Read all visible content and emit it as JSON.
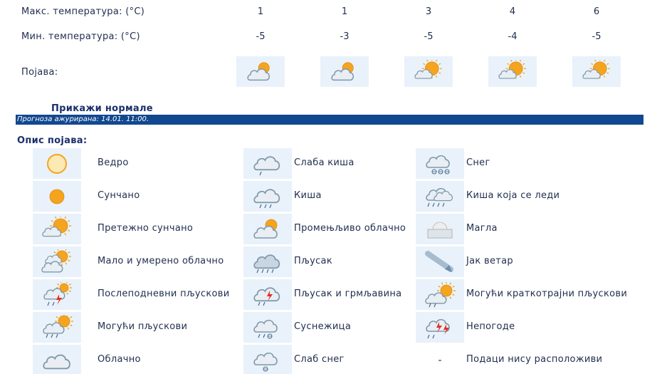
{
  "forecast": {
    "max_label": "Макс. температура: (°C)",
    "min_label": "Мин. температура: (°C)",
    "phenomenon_label": "Појава:",
    "days": [
      {
        "max": "1",
        "min": "-5",
        "icon": "partly-cloudy-icon"
      },
      {
        "max": "1",
        "min": "-3",
        "icon": "partly-cloudy-icon"
      },
      {
        "max": "3",
        "min": "-5",
        "icon": "mostly-sunny-icon"
      },
      {
        "max": "4",
        "min": "-4",
        "icon": "mostly-sunny-icon"
      },
      {
        "max": "6",
        "min": "-5",
        "icon": "mostly-sunny-icon"
      }
    ]
  },
  "show_normals": "Прикажи нормале",
  "updated": "Прогноза ажурирана:  14.01. 11:00.",
  "legend": {
    "title": "Опис појава:",
    "columns": [
      [
        {
          "icon": "clear-sun-icon",
          "label": "Ведро"
        },
        {
          "icon": "sunny-icon",
          "label": "Сунчано"
        },
        {
          "icon": "mostly-sunny-icon",
          "label": "Претежно сунчано"
        },
        {
          "icon": "small-moderate-cloud-icon",
          "label": "Мало и умерено облачно"
        },
        {
          "icon": "afternoon-showers-icon",
          "label": "Послеподневни пљускови"
        },
        {
          "icon": "possible-showers-icon",
          "label": "Могући пљускови"
        },
        {
          "icon": "cloudy-icon",
          "label": "Облачно"
        }
      ],
      [
        {
          "icon": "light-rain-icon",
          "label": "Слаба киша"
        },
        {
          "icon": "rain-icon",
          "label": "Киша"
        },
        {
          "icon": "partly-cloudy-icon",
          "label": "Промењљиво облачно"
        },
        {
          "icon": "downpour-icon",
          "label": "Пљусак"
        },
        {
          "icon": "thunderstorm-icon",
          "label": "Пљусак и грмљавина"
        },
        {
          "icon": "sleet-icon",
          "label": "Суснежица"
        },
        {
          "icon": "light-snow-icon",
          "label": "Слаб снег"
        }
      ],
      [
        {
          "icon": "snow-icon",
          "label": "Снег"
        },
        {
          "icon": "freezing-rain-icon",
          "label": "Киша која се леди"
        },
        {
          "icon": "fog-icon",
          "label": "Магла"
        },
        {
          "icon": "strong-wind-icon",
          "label": "Јак ветар"
        },
        {
          "icon": "possible-short-showers-icon",
          "label": "Могући краткотрајни пљускови"
        },
        {
          "icon": "severe-storm-icon",
          "label": "Непогоде"
        },
        {
          "icon": "no-data-icon",
          "label": "Подаци нису расположиви",
          "dash": "-"
        }
      ]
    ]
  },
  "colors": {
    "sun": "#f5a41e",
    "cloud": "#7e98ad",
    "cloud_light": "#e8eef3",
    "bar": "#11488f",
    "cell": "#e9f2fa",
    "bolt": "#e0302a",
    "drop": "#4a6b8a"
  }
}
